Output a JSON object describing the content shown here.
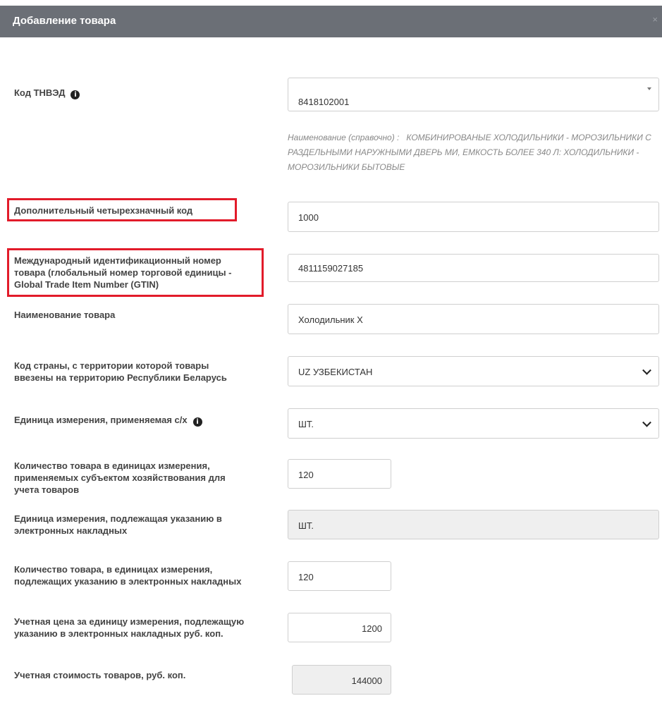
{
  "dialog": {
    "title": "Добавление товара",
    "close_label": "×"
  },
  "form": {
    "tnved": {
      "label": "Код ТНВЭД",
      "value": "8418102001",
      "hint_prefix": "Наименование (справочно) :",
      "hint_text": "КОМБИНИРОВАНЫЕ ХОЛОДИЛЬНИКИ - МОРОЗИЛЬНИКИ С РАЗДЕЛЬНЫМИ НАРУЖНЫМИ ДВЕРЬ МИ, ЕМКОСТЬ БОЛЕЕ 340 Л: ХОЛОДИЛЬНИКИ - МОРОЗИЛЬНИКИ БЫТОВЫЕ"
    },
    "extra_code": {
      "label": "Дополнительный четырехзначный код",
      "value": "1000"
    },
    "gtin": {
      "label_line1": "Международный идентификационный номер",
      "label_line2": "товара (глобальный номер торговой единицы -",
      "label_line3": "Global Trade Item Number (GTIN)",
      "value": "4811159027185"
    },
    "product_name": {
      "label": "Наименование товара",
      "value": "Холодильник X"
    },
    "country": {
      "label_line1": "Код страны, с территории которой товары",
      "label_line2": "ввезены на территорию Республики Беларусь",
      "value": "UZ УЗБЕКИСТАН"
    },
    "unit": {
      "label": "Единица измерения, применяемая с/х",
      "value": "ШТ."
    },
    "qty_subject": {
      "label_line1": "Количество товара в единицах измерения,",
      "label_line2": "применяемых субъектом хозяйствования для",
      "label_line3": "учета товаров",
      "value": "120"
    },
    "unit_invoice": {
      "label_line1": "Единица измерения, подлежащая указанию в",
      "label_line2": "электронных накладных",
      "value": "ШТ."
    },
    "qty_invoice": {
      "label_line1": "Количество товара, в единицах измерения,",
      "label_line2": "подлежащих указанию в электронных накладных",
      "value": "120"
    },
    "unit_price": {
      "label_line1": "Учетная цена за единицу измерения, подлежащую",
      "label_line2": "указанию в электронных накладных руб. коп.",
      "value": "1200"
    },
    "total_cost": {
      "label": "Учетная стоимость товаров, руб. коп.",
      "value": "144000"
    }
  },
  "colors": {
    "titlebar": "#6b6f76",
    "highlight": "#e21b2a",
    "readonly_bg": "#efefef"
  }
}
